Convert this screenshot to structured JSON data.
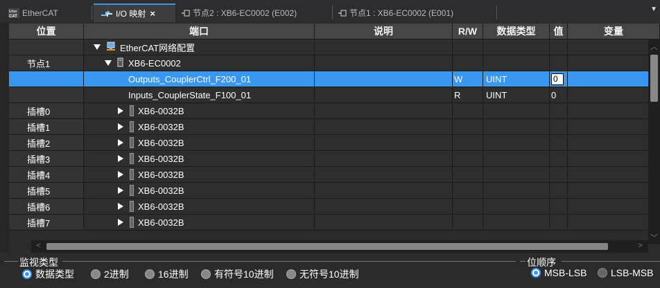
{
  "tabs": [
    {
      "label": "EtherCAT",
      "icon": "ethercat-icon",
      "active": false
    },
    {
      "label": "I/O 映射",
      "icon": "io-map-icon",
      "active": true,
      "close": "×"
    },
    {
      "label": "节点2 : XB6-EC0002 (E002)",
      "icon": "node-tab-icon",
      "active": false
    },
    {
      "label": "节点1 : XB6-EC0002 (E001)",
      "icon": "node-tab-icon",
      "active": false
    }
  ],
  "overflow_arrow": "▼",
  "columns": [
    "位置",
    "端口",
    "说明",
    "R/W",
    "数据类型",
    "值",
    "变量"
  ],
  "rows": [
    {
      "pos": "",
      "port": "EtherCAT网络配置",
      "desc": "",
      "rw": "",
      "type": "",
      "value": "",
      "var": ""
    },
    {
      "pos": "节点1",
      "port": "XB6-EC0002",
      "desc": "",
      "rw": "",
      "type": "",
      "value": "",
      "var": ""
    },
    {
      "pos": "",
      "port": "Outputs_CouplerCtrl_F200_01",
      "desc": "",
      "rw": "W",
      "type": "UINT",
      "value": "0",
      "var": ""
    },
    {
      "pos": "",
      "port": "Inputs_CouplerState_F100_01",
      "desc": "",
      "rw": "R",
      "type": "UINT",
      "value": "0",
      "var": ""
    },
    {
      "pos": "插槽0",
      "port": "XB6-0032B",
      "desc": "",
      "rw": "",
      "type": "",
      "value": "",
      "var": ""
    },
    {
      "pos": "插槽1",
      "port": "XB6-0032B",
      "desc": "",
      "rw": "",
      "type": "",
      "value": "",
      "var": ""
    },
    {
      "pos": "插槽2",
      "port": "XB6-0032B",
      "desc": "",
      "rw": "",
      "type": "",
      "value": "",
      "var": ""
    },
    {
      "pos": "插槽3",
      "port": "XB6-0032B",
      "desc": "",
      "rw": "",
      "type": "",
      "value": "",
      "var": ""
    },
    {
      "pos": "插槽4",
      "port": "XB6-0032B",
      "desc": "",
      "rw": "",
      "type": "",
      "value": "",
      "var": ""
    },
    {
      "pos": "插槽5",
      "port": "XB6-0032B",
      "desc": "",
      "rw": "",
      "type": "",
      "value": "",
      "var": ""
    },
    {
      "pos": "插槽6",
      "port": "XB6-0032B",
      "desc": "",
      "rw": "",
      "type": "",
      "value": "",
      "var": ""
    },
    {
      "pos": "插槽7",
      "port": "XB6-0032B",
      "desc": "",
      "rw": "",
      "type": "",
      "value": "",
      "var": ""
    }
  ],
  "monitor": {
    "title": "监视类型",
    "options": [
      "数据类型",
      "2进制",
      "16进制",
      "有符号10进制",
      "无符号10进制"
    ],
    "selected": "数据类型"
  },
  "bit_order": {
    "title": "位顺序",
    "options": [
      "MSB-LSB",
      "LSB-MSB"
    ],
    "selected": "MSB-LSB"
  },
  "colors": {
    "selection": "#3897f0",
    "accent": "#3f94e5"
  }
}
